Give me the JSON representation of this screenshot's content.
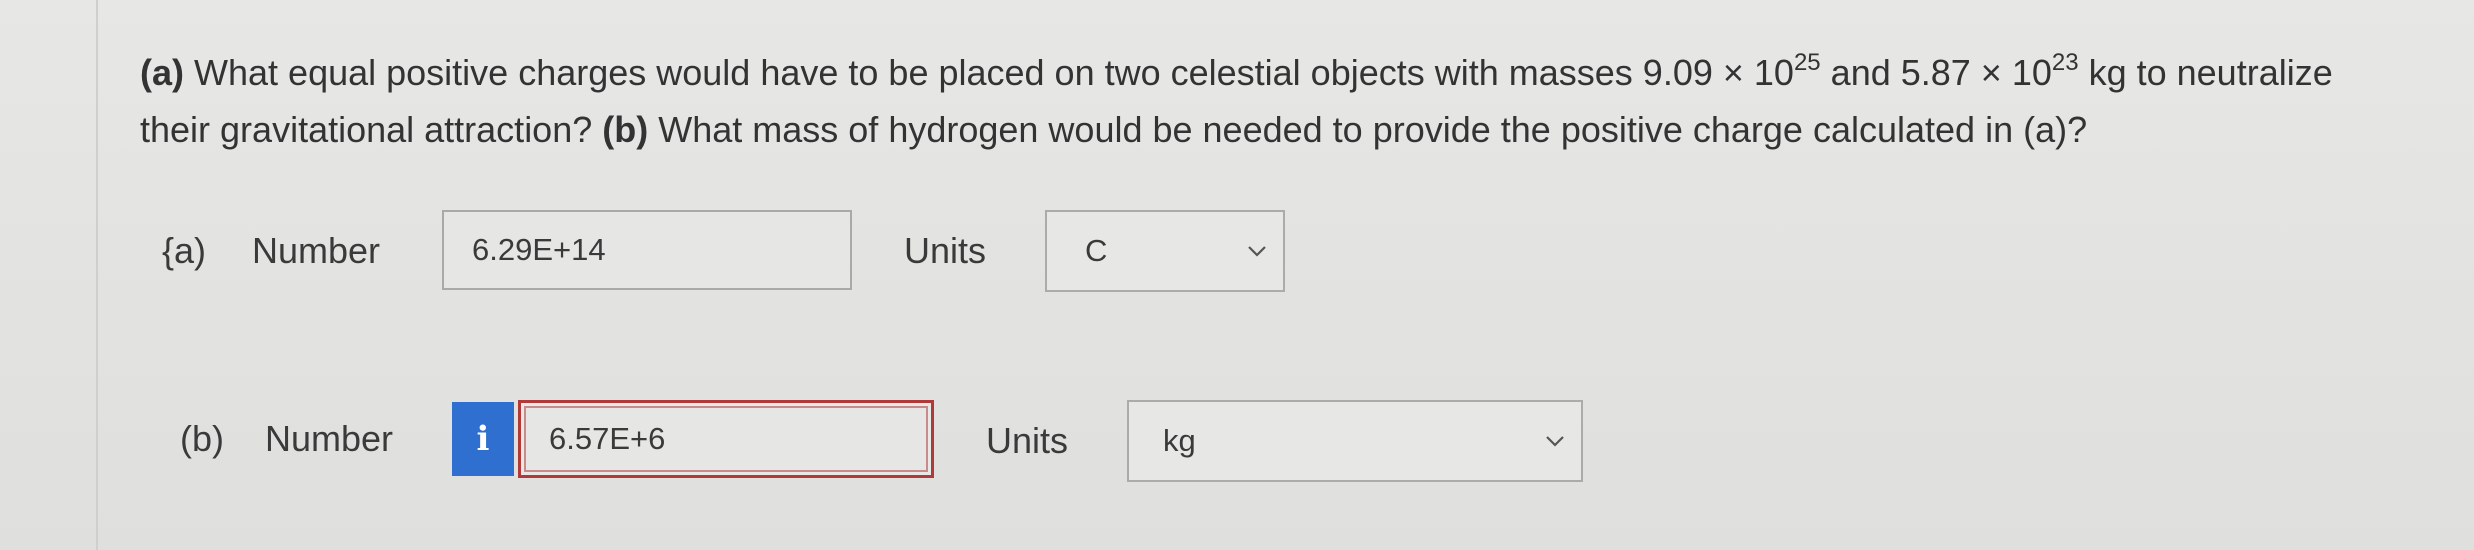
{
  "question": {
    "part_a_label": "(a)",
    "part_a_text_1": "What equal positive charges would have to be placed on two celestial objects with masses 9.09 × 10",
    "part_a_exp_1": "25",
    "part_a_text_2": "and 5.87 × 10",
    "part_a_exp_2": "23",
    "part_a_text_3": "kg to neutralize their gravitational attraction?",
    "part_b_label": "(b)",
    "part_b_text": "What mass of hydrogen would be needed to provide the positive charge calculated in (a)?"
  },
  "answers": [
    {
      "part_label": "{a)",
      "number_label": "Number",
      "value": "6.29E+14",
      "units_label": "Units",
      "unit_selected": "C",
      "state": "normal"
    },
    {
      "part_label": "(b)",
      "number_label": "Number",
      "info_icon": "i",
      "value": "6.57E+6",
      "units_label": "Units",
      "unit_selected": "kg",
      "state": "error"
    }
  ],
  "colors": {
    "info_badge": "#2f6fd0",
    "error_border": "#b03a3a"
  },
  "icons": {
    "info": "info-icon",
    "dropdown": "chevron-down-icon"
  }
}
